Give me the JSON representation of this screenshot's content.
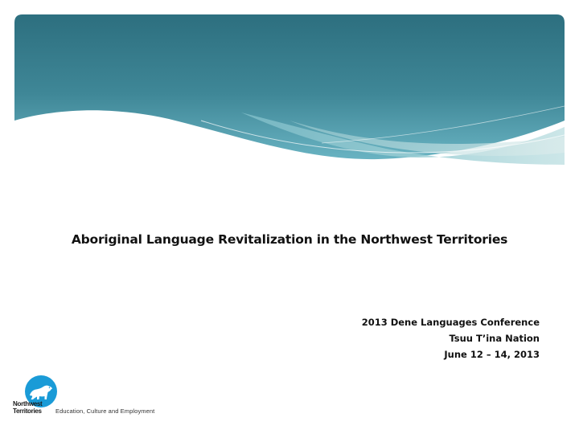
{
  "slide": {
    "title": "Aboriginal Language Revitalization in the Northwest Territories",
    "conference": {
      "event": "2013 Dene Languages Conference",
      "location": "Tsuu T’ina Nation",
      "dates": "June 12 – 14, 2013"
    },
    "logo": {
      "name_line1": "Northwest",
      "name_line2": "Territories",
      "department": "Education, Culture and Employment",
      "icon": "polar-bear-icon"
    }
  },
  "colors": {
    "band_top": "#2d6f7f",
    "band_mid": "#4d97a8",
    "band_light": "#8fc7cf",
    "logo_blue": "#1a9bd7",
    "text": "#111111"
  }
}
